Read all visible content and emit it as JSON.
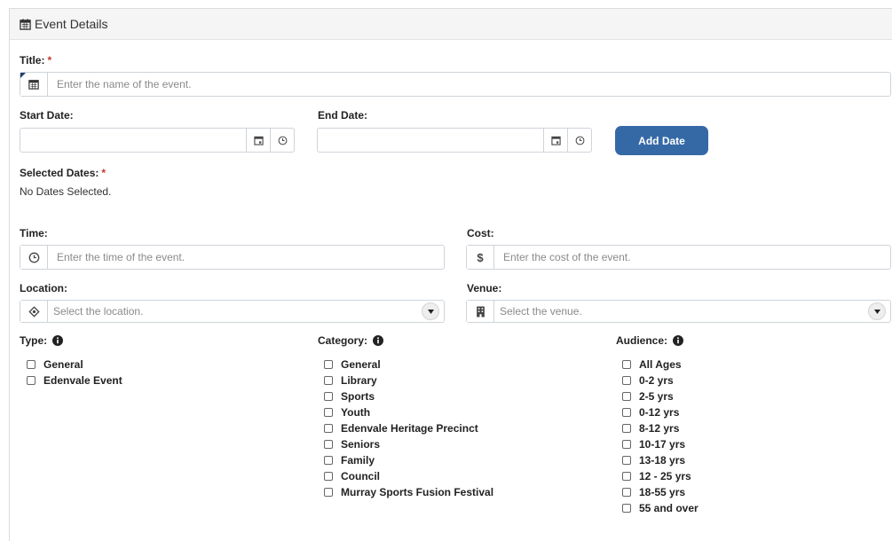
{
  "header": {
    "title": "Event Details",
    "icon": "calendar-icon"
  },
  "title_field": {
    "label": "Title:",
    "required": "*",
    "placeholder": "Enter the name of the event.",
    "value": ""
  },
  "start_date": {
    "label": "Start Date:",
    "value": ""
  },
  "end_date": {
    "label": "End Date:",
    "value": ""
  },
  "add_date_button": {
    "label": "Add Date",
    "color": "#3569a6"
  },
  "selected_dates": {
    "label": "Selected Dates:",
    "required": "*",
    "empty_text": "No Dates Selected."
  },
  "time_field": {
    "label": "Time:",
    "placeholder": "Enter the time of the event.",
    "value": ""
  },
  "cost_field": {
    "label": "Cost:",
    "placeholder": "Enter the cost of the event.",
    "value": "",
    "addon": "$"
  },
  "location_field": {
    "label": "Location:",
    "placeholder": "Select the location."
  },
  "venue_field": {
    "label": "Venue:",
    "placeholder": "Select the venue."
  },
  "type": {
    "label": "Type:",
    "options": [
      "General",
      "Edenvale Event"
    ]
  },
  "category": {
    "label": "Category:",
    "options": [
      "General",
      "Library",
      "Sports",
      "Youth",
      "Edenvale Heritage Precinct",
      "Seniors",
      "Family",
      "Council",
      "Murray Sports Fusion Festival"
    ]
  },
  "audience": {
    "label": "Audience:",
    "options": [
      "All Ages",
      "0-2 yrs",
      "2-5 yrs",
      "0-12 yrs",
      "8-12 yrs",
      "10-17 yrs",
      "13-18 yrs",
      "12 - 25 yrs",
      "18-55 yrs",
      "55 and over"
    ]
  },
  "colors": {
    "required": "#c0392b",
    "accent": "#3569a6"
  }
}
